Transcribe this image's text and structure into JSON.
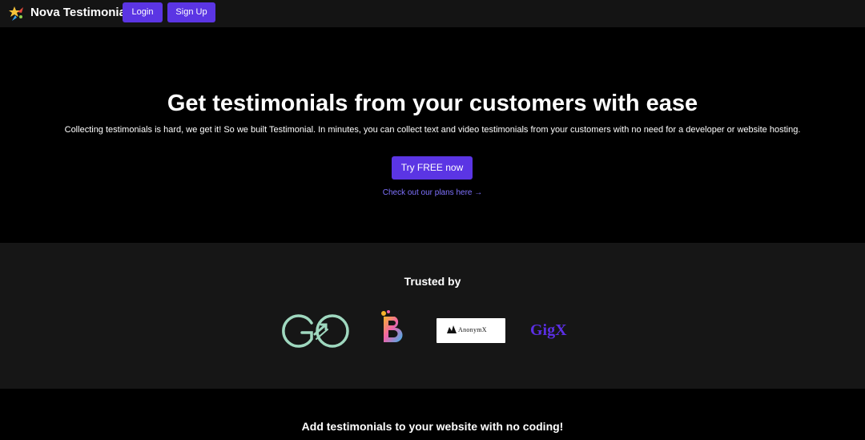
{
  "nav": {
    "brand": "Nova Testimonial",
    "logo_icon": "rocket-star-icon",
    "login_label": "Login",
    "signup_label": "Sign Up"
  },
  "hero": {
    "title": "Get testimonials from your customers with ease",
    "subtitle": "Collecting testimonials is hard, we get it! So we built Testimonial. In minutes, you can collect text and video testimonials from your customers with no need for a developer or website hosting.",
    "cta_label": "Try FREE now",
    "plans_link": "Check out our plans here →"
  },
  "trusted": {
    "title": "Trusted by",
    "logos": [
      "GO",
      "B",
      "AnonymX",
      "GigX"
    ]
  },
  "bottom": {
    "title": "Add testimonials to your website with no coding!"
  },
  "colors": {
    "accent": "#5b35e4",
    "link": "#7f72ff",
    "nav_bg": "#141414",
    "section_bg": "#161616",
    "page_bg": "#000000"
  }
}
